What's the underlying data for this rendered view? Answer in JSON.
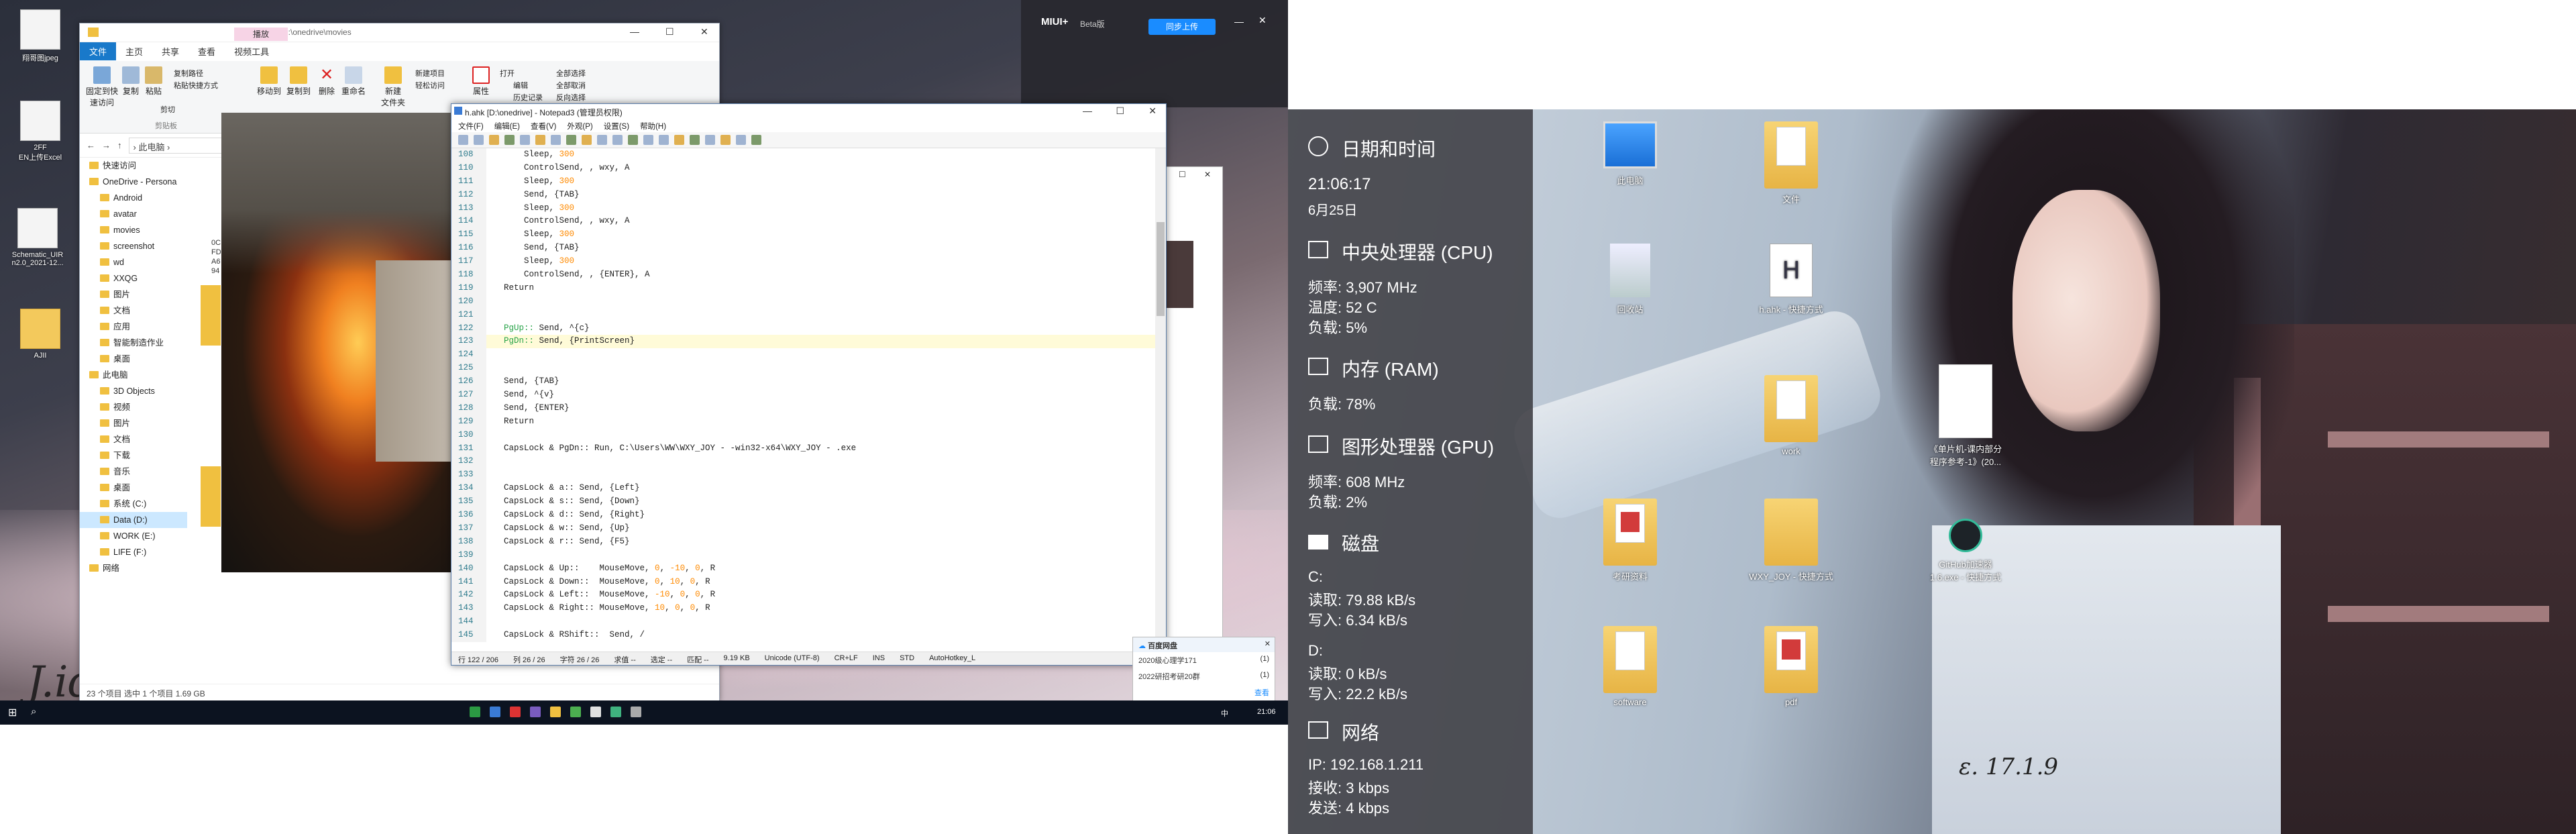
{
  "left_desktop": {
    "icons": [
      {
        "label": "翔哥图jpeg"
      },
      {
        "label": "2FF\nEN上传Excel"
      },
      {
        "label": "Schematic_UIR\nn2.0_2021-12..."
      },
      {
        "label": "AJII"
      }
    ],
    "signature": "J.idea"
  },
  "explorer": {
    "title_path": "D:\\onedrive\\movies",
    "tabs": [
      "文件",
      "主页",
      "共享",
      "查看",
      "视频工具"
    ],
    "context_tab": "播放",
    "ribbon": {
      "pin": "固定到快\n速访问",
      "copy": "复制",
      "paste": "粘贴",
      "copy_path": "复制路径",
      "paste_shortcut": "粘贴快捷方式",
      "cut": "剪切",
      "move_to": "移动到",
      "copy_to": "复制到",
      "delete": "删除",
      "rename": "重命名",
      "new_folder": "新建\n文件夹",
      "new_item": "新建项目",
      "easy_access": "轻松访问",
      "properties": "属性",
      "open": "打开",
      "edit": "编辑",
      "history": "历史记录",
      "select_all": "全部选择",
      "select_none": "全部取消",
      "invert": "反向选择",
      "group_clipboard": "剪贴板"
    },
    "address": {
      "path": "› 此电脑 ›"
    },
    "nav": [
      {
        "label": "快速访问",
        "indent": 0
      },
      {
        "label": "OneDrive - Persona",
        "indent": 0
      },
      {
        "label": "Android",
        "indent": 1
      },
      {
        "label": "avatar",
        "indent": 1
      },
      {
        "label": "movies",
        "indent": 1
      },
      {
        "label": "screenshot",
        "indent": 1
      },
      {
        "label": "wd",
        "indent": 1
      },
      {
        "label": "XXQG",
        "indent": 1
      },
      {
        "label": "图片",
        "indent": 1
      },
      {
        "label": "文档",
        "indent": 1
      },
      {
        "label": "应用",
        "indent": 1
      },
      {
        "label": "智能制造作业",
        "indent": 1
      },
      {
        "label": "桌面",
        "indent": 1
      },
      {
        "label": "此电脑",
        "indent": 0
      },
      {
        "label": "3D Objects",
        "indent": 1
      },
      {
        "label": "视频",
        "indent": 1
      },
      {
        "label": "图片",
        "indent": 1
      },
      {
        "label": "文档",
        "indent": 1
      },
      {
        "label": "下载",
        "indent": 1
      },
      {
        "label": "音乐",
        "indent": 1
      },
      {
        "label": "桌面",
        "indent": 1
      },
      {
        "label": "系统 (C:)",
        "indent": 1
      },
      {
        "label": "Data (D:)",
        "indent": 1,
        "selected": true
      },
      {
        "label": "WORK (E:)",
        "indent": 1
      },
      {
        "label": "LIFE (F:)",
        "indent": 1
      },
      {
        "label": "网络",
        "indent": 0
      }
    ],
    "file_snippets": [
      "0C",
      "FD",
      "A6",
      "94"
    ],
    "status": "23 个项目    选中 1 个项目  1.69 GB"
  },
  "notepad": {
    "title": "h.ahk [D:\\onedrive] - Notepad3  (管理员权限)",
    "menu": [
      "文件(F)",
      "编辑(E)",
      "查看(V)",
      "外观(P)",
      "设置(S)",
      "帮助(H)"
    ],
    "lines": [
      {
        "no": "108",
        "text": "    Sleep, 300",
        "num": "300"
      },
      {
        "no": "110",
        "text": "    ControlSend, , wxy, A"
      },
      {
        "no": "111",
        "text": "    Sleep, 300",
        "num": "300"
      },
      {
        "no": "112",
        "text": "    Send, {TAB}"
      },
      {
        "no": "113",
        "text": "    Sleep, 300",
        "num": "300"
      },
      {
        "no": "114",
        "text": "    ControlSend, , wxy, A"
      },
      {
        "no": "115",
        "text": "    Sleep, 300",
        "num": "300"
      },
      {
        "no": "116",
        "text": "    Send, {TAB}"
      },
      {
        "no": "117",
        "text": "    Sleep, 300",
        "num": "300"
      },
      {
        "no": "118",
        "text": "    ControlSend, , {ENTER}, A"
      },
      {
        "no": "119",
        "text": "Return"
      },
      {
        "no": "120",
        "text": ""
      },
      {
        "no": "121",
        "text": ""
      },
      {
        "no": "122",
        "text": "PgUp:: Send, ^{c}",
        "kw": "PgUp::"
      },
      {
        "no": "123",
        "text": "PgDn:: Send, {PrintScreen}",
        "kw": "PgDn::",
        "current": true
      },
      {
        "no": "124",
        "text": ""
      },
      {
        "no": "125",
        "text": ""
      },
      {
        "no": "126",
        "text": "Send, {TAB}"
      },
      {
        "no": "127",
        "text": "Send, ^{v}"
      },
      {
        "no": "128",
        "text": "Send, {ENTER}"
      },
      {
        "no": "129",
        "text": "Return"
      },
      {
        "no": "130",
        "text": ""
      },
      {
        "no": "131",
        "text": "CapsLock & PgDn:: Run, C:\\Users\\WW\\WXY_JOY - -win32-x64\\WXY_JOY - .exe"
      },
      {
        "no": "132",
        "text": ""
      },
      {
        "no": "133",
        "text": ""
      },
      {
        "no": "134",
        "text": "CapsLock & a:: Send, {Left}"
      },
      {
        "no": "135",
        "text": "CapsLock & s:: Send, {Down}"
      },
      {
        "no": "136",
        "text": "CapsLock & d:: Send, {Right}"
      },
      {
        "no": "137",
        "text": "CapsLock & w:: Send, {Up}"
      },
      {
        "no": "138",
        "text": "CapsLock & r:: Send, {F5}"
      },
      {
        "no": "139",
        "text": ""
      },
      {
        "no": "140",
        "text": "CapsLock & Up::    MouseMove, 0, -10, 0, R"
      },
      {
        "no": "141",
        "text": "CapsLock & Down::  MouseMove, 0, 10, 0, R"
      },
      {
        "no": "142",
        "text": "CapsLock & Left::  MouseMove, -10, 0, 0, R"
      },
      {
        "no": "143",
        "text": "CapsLock & Right:: MouseMove, 10, 0, 0, R"
      },
      {
        "no": "144",
        "text": ""
      },
      {
        "no": "145",
        "text": "CapsLock & RShift::  Send, /"
      }
    ],
    "status": [
      "行  122 / 206",
      "列  26 / 26",
      "字符  26 / 26",
      "求值  --",
      "选定  --",
      "匹配  --",
      "9.19 KB",
      "Unicode (UTF-8)",
      "CR+LF",
      "INS",
      "STD",
      "AutoHotkey_L"
    ]
  },
  "miui": {
    "title": "MIUI+",
    "badge": "Beta版",
    "button": "同步上传"
  },
  "toast": {
    "header": "百度网盘",
    "rows": [
      {
        "name": "2020级心理学171",
        "count": "(1)"
      },
      {
        "name": "2022研招考研20群",
        "count": "(1)"
      }
    ],
    "more": "查看"
  },
  "taskbar": {
    "time": "21:06",
    "lang": "中"
  },
  "rainmeter": {
    "datetime": {
      "title": "日期和时间",
      "time": "21:06:17",
      "date": "6月25日"
    },
    "cpu": {
      "title": "中央处理器 (CPU)",
      "freq": "频率: 3,907 MHz",
      "temp": "温度: 52 C",
      "load": "负载: 5%"
    },
    "ram": {
      "title": "内存 (RAM)",
      "load": "负载: 78%"
    },
    "gpu": {
      "title": "图形处理器 (GPU)",
      "freq": "频率: 608 MHz",
      "load": "负载: 2%"
    },
    "disk": {
      "title": "磁盘",
      "c_label": "C:",
      "c_read": "读取: 79.88 kB/s",
      "c_write": "写入: 6.34 kB/s",
      "d_label": "D:",
      "d_read": "读取: 0 kB/s",
      "d_write": "写入: 22.2 kB/s"
    },
    "net": {
      "title": "网络",
      "ip": "IP: 192.168.1.211",
      "recv": "接收: 3 kbps",
      "send": "发送: 4 kbps"
    }
  },
  "right_desktop": {
    "icons": [
      {
        "label": "此电脑"
      },
      {
        "label": "文件"
      },
      {
        "label": "回收站"
      },
      {
        "label": "h.ahk - 快捷方式"
      },
      {
        "label": "work"
      },
      {
        "label": "《单片机-课内部分\n程序参考-1》(20..."
      },
      {
        "label": "考研资料"
      },
      {
        "label": "WXY_JOY - 快捷方式"
      },
      {
        "label": "GitHub加速器\n1.6.exe - 快捷方式"
      },
      {
        "label": "software"
      },
      {
        "label": "pdf"
      }
    ],
    "signature": "ε. 17.1.9"
  }
}
